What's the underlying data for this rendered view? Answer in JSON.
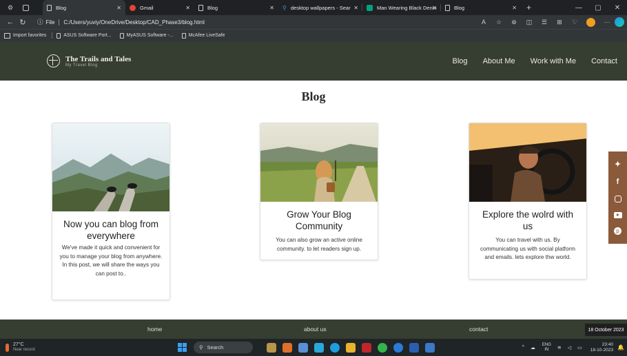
{
  "browser": {
    "tabs": [
      {
        "title": "Blog",
        "favicon": "page-icon",
        "active": true
      },
      {
        "title": "Gmail",
        "favicon": "gmail-icon",
        "active": false
      },
      {
        "title": "Blog",
        "favicon": "page-icon",
        "active": false
      },
      {
        "title": "desktop wallpapers - Sear",
        "favicon": "search-icon",
        "active": false
      },
      {
        "title": "Man Wearing Black Denin",
        "favicon": "pexels-icon",
        "active": false
      },
      {
        "title": "Blog",
        "favicon": "page-icon",
        "active": false
      }
    ],
    "address": {
      "prefix": "File",
      "url": "C:/Users/yuviy/OneDrive/Desktop/CAD_Phase3/blog.html"
    },
    "favorites": [
      "Import favorites",
      "ASUS Software Port...",
      "MyASUS Software -...",
      "McAfee LiveSafe"
    ]
  },
  "site": {
    "brand": {
      "title": "The Trails and Tales",
      "subtitle": "My Travel Blog"
    },
    "nav": [
      "Blog",
      "About Me",
      "Work with Me",
      "Contact"
    ],
    "page_title": "Blog",
    "cards": [
      {
        "title": "Now you can blog from everywhere",
        "text": "We've made it quick and convenient for you to manage your blog from anywhere. In this post, we will share the ways you can post to.."
      },
      {
        "title": "Grow Your Blog Community",
        "text": "You can also grow an active online community. to let readers sign up."
      },
      {
        "title": "Explore the wolrd with us",
        "text": "You can travel with us. By communicating us with social platform and emails. lets explore thw world."
      }
    ],
    "social": [
      "twitter-icon",
      "facebook-icon",
      "instagram-icon",
      "youtube-icon",
      "pinterest-icon"
    ],
    "footer": [
      "home",
      "about us",
      "contact"
    ],
    "date_chip": "18 October 2023"
  },
  "taskbar": {
    "weather_temp": "27°C",
    "weather_desc": "Near record",
    "search_label": "Search",
    "lang_top": "ENG",
    "lang_bottom": "IN",
    "time": "23:40",
    "date": "18-10-2023"
  },
  "colors": {
    "header_bg": "#363d31",
    "social_bg": "#8b5a3a",
    "browser_bg": "#323639"
  }
}
